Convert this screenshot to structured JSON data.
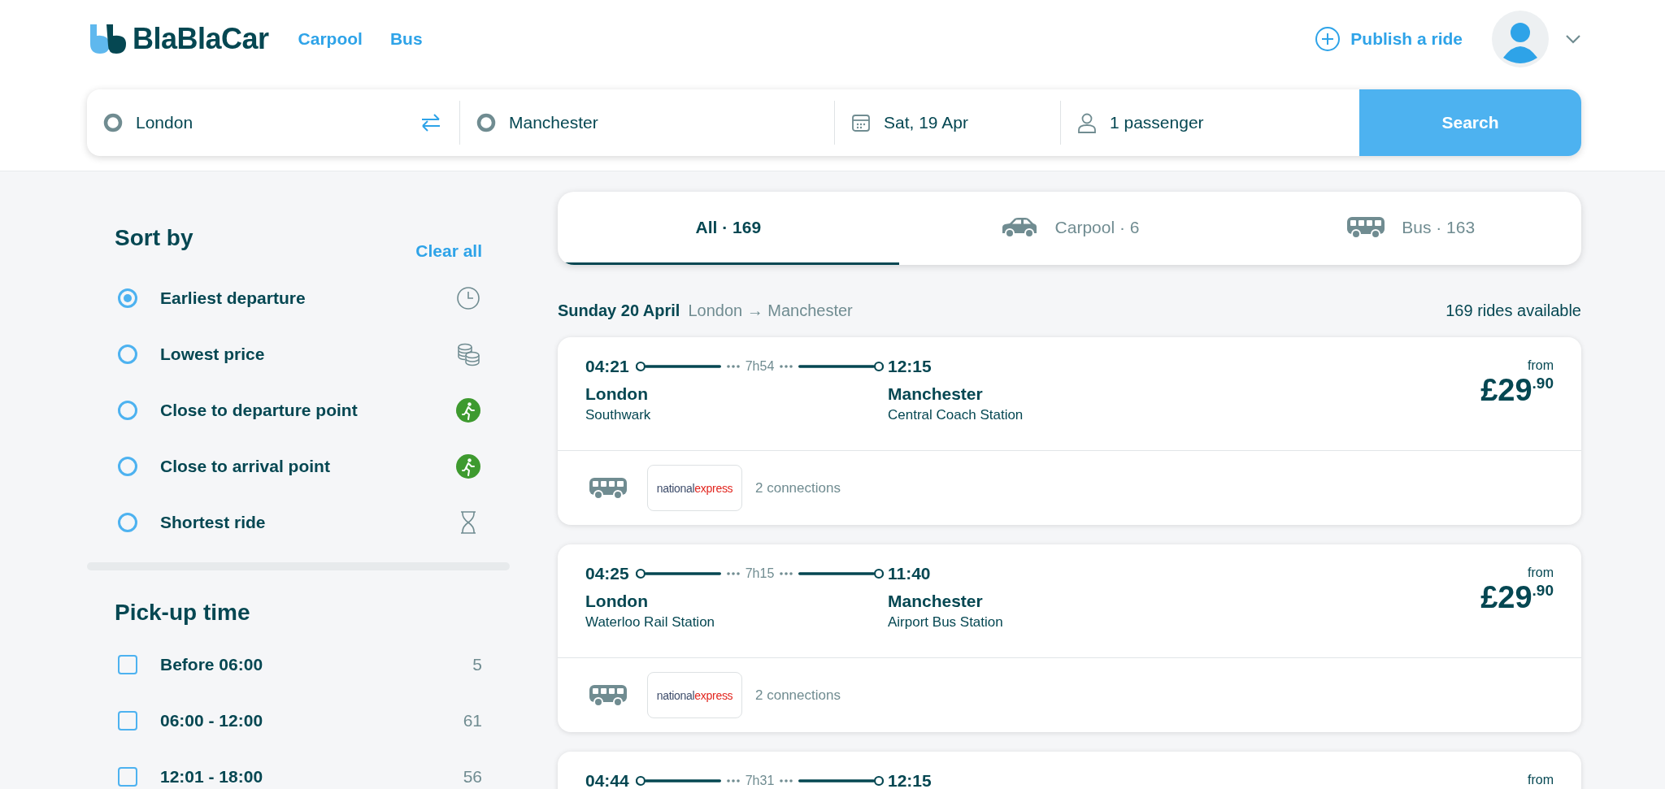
{
  "header": {
    "logo": "BlaBlaCar",
    "nav": [
      {
        "label": "Carpool"
      },
      {
        "label": "Bus"
      }
    ],
    "publish": "Publish a ride"
  },
  "search": {
    "from": "London",
    "to": "Manchester",
    "date": "Sat, 19 Apr",
    "passengers": "1 passenger",
    "button": "Search"
  },
  "sort": {
    "title": "Sort by",
    "clear": "Clear all",
    "options": [
      {
        "label": "Earliest departure",
        "selected": true
      },
      {
        "label": "Lowest price",
        "selected": false
      },
      {
        "label": "Close to departure point",
        "selected": false
      },
      {
        "label": "Close to arrival point",
        "selected": false
      },
      {
        "label": "Shortest ride",
        "selected": false
      }
    ]
  },
  "pickup": {
    "title": "Pick-up time",
    "options": [
      {
        "label": "Before 06:00",
        "count": "5",
        "checked": false
      },
      {
        "label": "06:00 - 12:00",
        "count": "61",
        "checked": false
      },
      {
        "label": "12:01 - 18:00",
        "count": "56",
        "checked": false
      }
    ]
  },
  "tabs": [
    {
      "label": "All · 169",
      "selected": true
    },
    {
      "label": "Carpool · 6",
      "selected": false
    },
    {
      "label": "Bus · 163",
      "selected": false
    }
  ],
  "results": {
    "date": "Sunday 20 April",
    "route": "London → Manchester",
    "count": "169 rides available"
  },
  "rides": [
    {
      "depart_time": "04:21",
      "duration": "7h54",
      "arrive_time": "12:15",
      "from_city": "London",
      "from_station": "Southwark",
      "to_city": "Manchester",
      "to_station": "Central Coach Station",
      "price_label": "from",
      "price": "£29$^{.90}$",
      "operator_logo": [
        "national",
        "express"
      ],
      "connections": "2 connections"
    },
    {
      "depart_time": "04:25",
      "duration": "7h15",
      "arrive_time": "11:40",
      "from_city": "London",
      "from_station": "Waterloo Rail Station",
      "to_city": "Manchester",
      "to_station": "Airport Bus Station",
      "price_label": "from",
      "price": "£29$^{.90}$",
      "operator_logo": [
        "national",
        "express"
      ],
      "connections": "2 connections"
    },
    {
      "depart_time": "04:44",
      "duration": "7h31",
      "arrive_time": "12:15",
      "price_label": "from"
    }
  ]
}
